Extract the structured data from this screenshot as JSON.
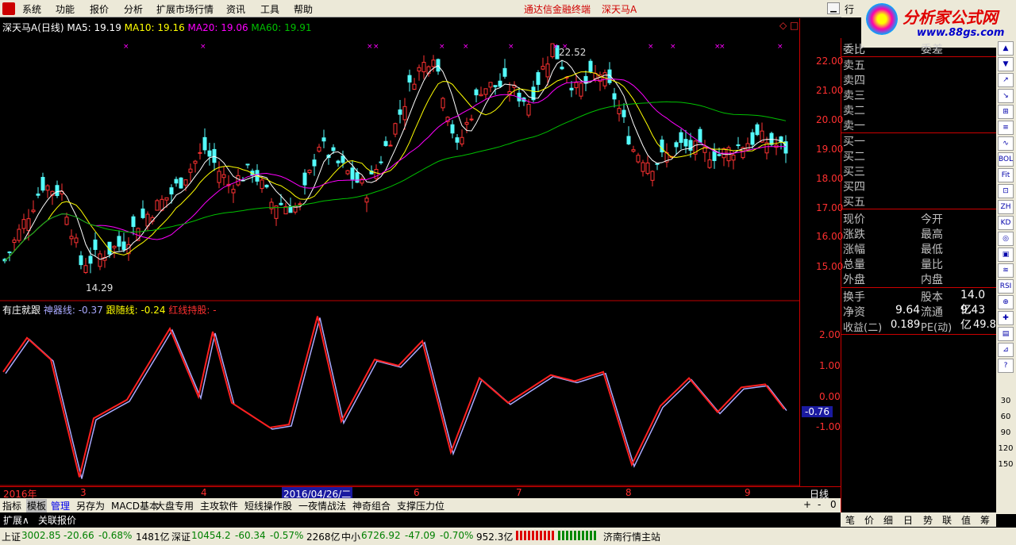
{
  "menu": {
    "items": [
      "系统",
      "功能",
      "报价",
      "分析",
      "扩展市场行情",
      "资讯",
      "工具",
      "帮助"
    ],
    "center_title": "通达信金融终端",
    "center_stock": "深天马A",
    "right_tab": "行"
  },
  "brand": {
    "title": "分析家公式网",
    "url": "www.88gs.com"
  },
  "chart_header": {
    "name": "深天马A",
    "period": "(日线)",
    "ma5": "MA5: 19.19",
    "ma10": "MA10: 19.16",
    "ma20": "MA20: 19.06",
    "ma60": "MA60: 19.91",
    "diamond": "◇",
    "square": "□"
  },
  "price_axis": {
    "labels": [
      "22.00",
      "21.00",
      "20.00",
      "19.00",
      "18.00",
      "17.00",
      "16.00",
      "15.00"
    ]
  },
  "price_annotations": {
    "high": "22.52",
    "low": "14.29"
  },
  "indicator_header": {
    "name": "有庄就跟",
    "line1": "神器线: -0.37",
    "line2": "跟随线: -0.24",
    "line3": "红线持股: -"
  },
  "indicator_axis": {
    "labels": [
      "2.00",
      "1.00",
      "0.00",
      "-1.00"
    ],
    "current": "-0.76"
  },
  "time_axis": {
    "labels": [
      "2016年",
      "3",
      "4",
      "2016/04/26/二",
      "6",
      "7",
      "8",
      "9"
    ],
    "period": "日线"
  },
  "quote_panel": {
    "header": [
      "委比",
      "委差"
    ],
    "asks": [
      "卖五",
      "卖四",
      "卖三",
      "卖二",
      "卖一"
    ],
    "bids": [
      "买一",
      "买二",
      "买三",
      "买四",
      "买五"
    ],
    "stats": [
      [
        "现价",
        "今开"
      ],
      [
        "涨跌",
        "最高"
      ],
      [
        "涨幅",
        "最低"
      ],
      [
        "总量",
        "量比"
      ],
      [
        "外盘",
        "内盘"
      ]
    ],
    "fund": [
      {
        "a": "换手",
        "b": "股本",
        "bv": "14.0亿"
      },
      {
        "a": "净资",
        "av": "9.64",
        "b": "流通",
        "bv": "9.43亿"
      },
      {
        "a": "收益(二)",
        "av": "0.189",
        "b": "PE(动)",
        "bv": "49.8"
      }
    ]
  },
  "bottom_tabs": [
    "指标",
    "模板",
    "管理",
    "另存为",
    "MACD基本",
    "大盘专用",
    "主攻软件",
    "短线操作股",
    "一夜情战法",
    "神奇组合",
    "支撑压力位"
  ],
  "tab_controls": [
    "+",
    "-",
    "0"
  ],
  "sub_tabs": [
    "扩展∧",
    "关联报价"
  ],
  "right_tabs": [
    "笔",
    "价",
    "细",
    "日",
    "势",
    "联",
    "值",
    "筹"
  ],
  "status": {
    "sh_label": "上证",
    "sh_val": "3002.85",
    "sh_chg": "-20.66",
    "sh_pct": "-0.68%",
    "sh_amt": "1481亿",
    "sz_label": "深证",
    "sz_val": "10454.2",
    "sz_chg": "-60.34",
    "sz_pct": "-0.57%",
    "sz_amt": "2268亿",
    "zx_label": "中小",
    "zx_val": "6726.92",
    "zx_chg": "-47.09",
    "zx_pct": "-0.70%",
    "zx_amt": "952.3亿",
    "site": "济南行情主站"
  },
  "side_icons": [
    "▲",
    "▼",
    "↗",
    "↘",
    "⊞",
    "≡",
    "∿",
    "BOL",
    "Fit",
    "⊡",
    "ZH",
    "KD",
    "◎",
    "▣",
    "≋",
    "RSI",
    "⊕",
    "✚",
    "▤",
    "⊿",
    "?"
  ],
  "colors": {
    "up": "#ff3232",
    "down": "#54fcfc",
    "ma5": "#ffffff",
    "ma10": "#ffff00",
    "ma20": "#ff00ff",
    "ma60": "#00c000"
  }
}
